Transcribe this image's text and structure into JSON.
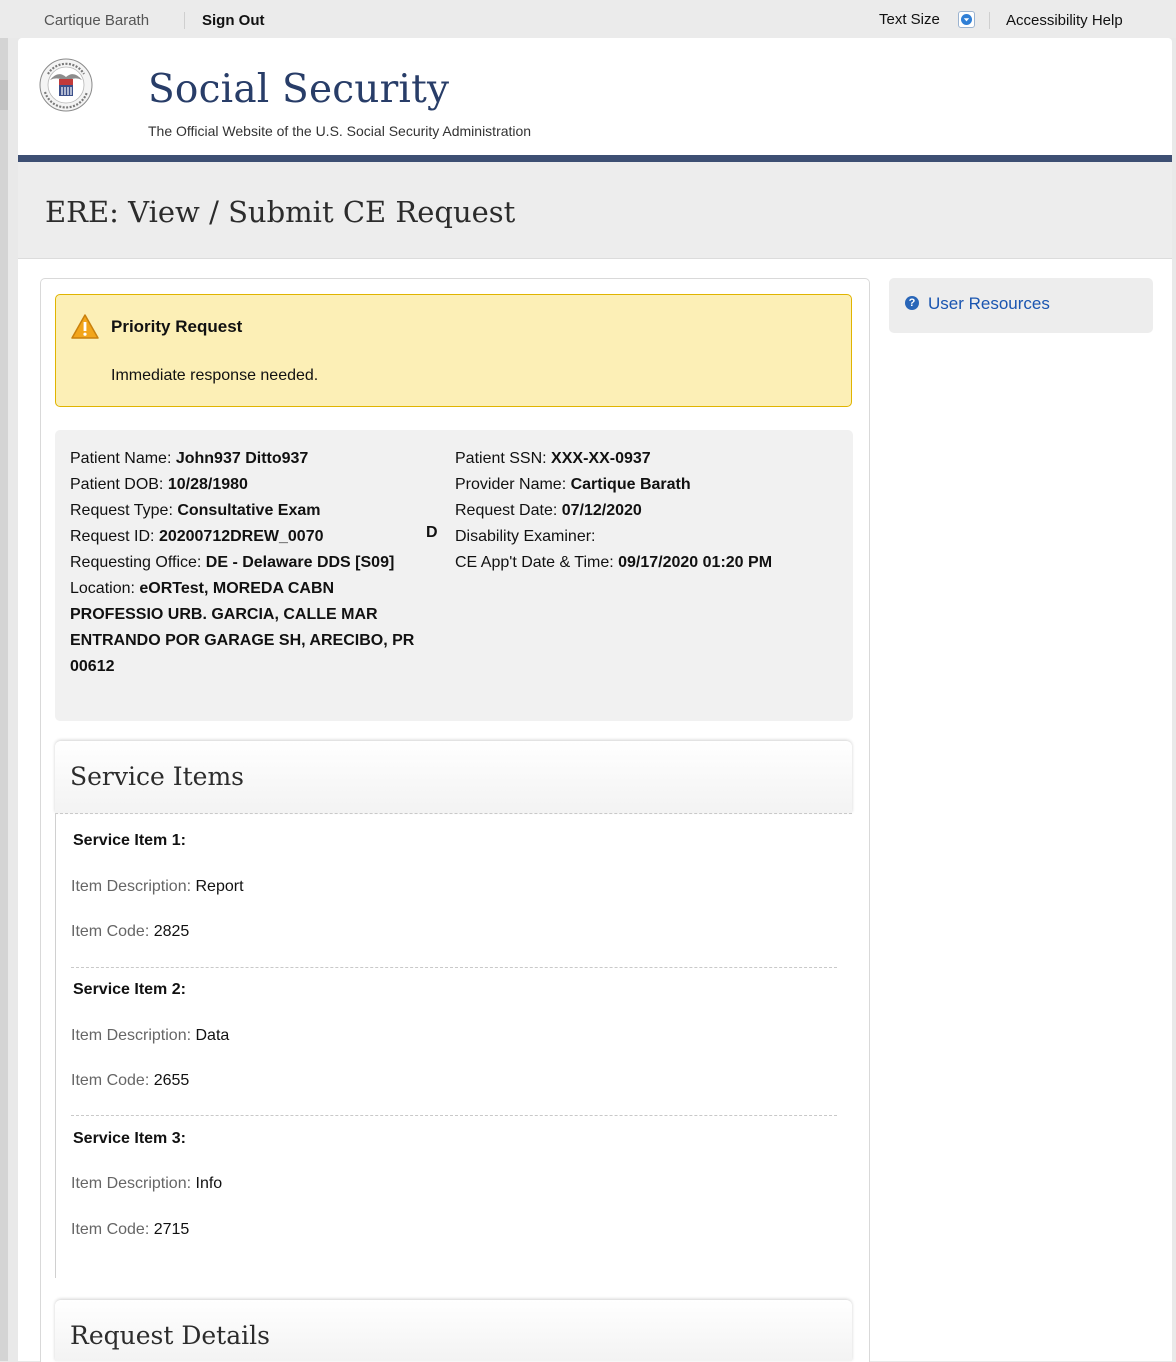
{
  "utility_bar": {
    "user_name": "Cartique Barath",
    "sign_out": "Sign Out",
    "text_size": "Text Size",
    "accessibility_help": "Accessibility Help"
  },
  "header": {
    "brand": "Social Security",
    "tagline": "The Official Website of the U.S. Social Security Administration",
    "seal_text": "SOCIAL SECURITY ADMINISTRATION USA"
  },
  "page": {
    "title": "ERE: View / Submit CE Request"
  },
  "alert": {
    "title": "Priority Request",
    "message": "Immediate response needed."
  },
  "patient_info": {
    "left": [
      {
        "label": "Patient Name: ",
        "value": "John937 Ditto937"
      },
      {
        "label": "Patient DOB: ",
        "value": "10/28/1980"
      },
      {
        "label": "Request Type: ",
        "value": "Consultative Exam"
      },
      {
        "label": "Request ID: ",
        "value": "20200712DREW_0070"
      },
      {
        "label": "Requesting Office: ",
        "value": "DE - Delaware DDS [S09]"
      },
      {
        "label": "Location: ",
        "value": "eORTest, MOREDA CABN PROFESSIO URB. GARCIA, CALLE MAR ENTRANDO POR GARAGE SH, ARECIBO, PR 00612"
      }
    ],
    "request_id_flag": "D",
    "right": [
      {
        "label": "Patient SSN: ",
        "value": "XXX-XX-0937"
      },
      {
        "label": "Provider Name: ",
        "value": "Cartique Barath"
      },
      {
        "label": "Request Date: ",
        "value": "07/12/2020"
      },
      {
        "label": "Disability Examiner:",
        "value": ""
      },
      {
        "label": "CE App't Date & Time: ",
        "value": "09/17/2020 01:20 PM"
      }
    ]
  },
  "service_items": {
    "heading": "Service Items",
    "description_label": "Item Description:",
    "code_label": "Item Code:",
    "items": [
      {
        "title": "Service Item 1:",
        "description": "Report",
        "code": "2825"
      },
      {
        "title": "Service Item 2:",
        "description": "Data",
        "code": "2655"
      },
      {
        "title": "Service Item 3:",
        "description": "Info",
        "code": "2715"
      }
    ]
  },
  "request_details": {
    "heading": "Request Details"
  },
  "sidebar": {
    "user_resources": "User Resources"
  },
  "colors": {
    "navy_rule": "#3d4f73",
    "brand_text": "#283d68",
    "alert_bg": "#fcefb6",
    "alert_border": "#e0b400",
    "link": "#1a55b0"
  }
}
